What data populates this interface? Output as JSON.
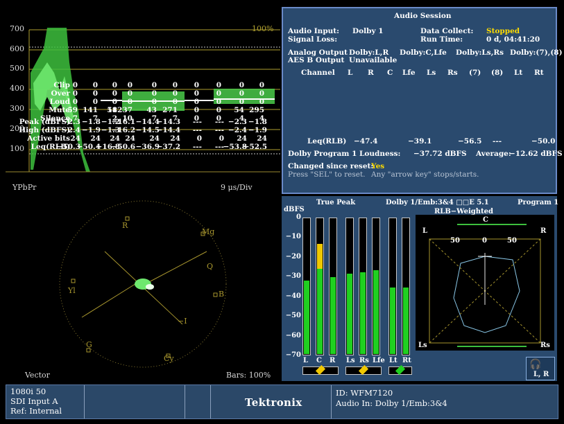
{
  "waveform": {
    "ticks": [
      "700",
      "600",
      "500",
      "400",
      "300",
      "200",
      "100"
    ],
    "percent": "100%",
    "format": "YPbPr",
    "scale": "9 μs/Div"
  },
  "audio_session": {
    "title": "Audio Session",
    "input_label": "Audio Input:",
    "input_value": "Dolby 1",
    "collect_label": "Data Collect:",
    "collect_value": "Stopped",
    "signal_loss": "Signal Loss:",
    "runtime_label": "Run Time:",
    "runtime_value": "0 d, 04:41:20",
    "analog_label": "Analog Output",
    "analog_vals": [
      "Dolby:L,R",
      "Dolby:C,Lfe",
      "Dolby:Ls,Rs",
      "Dolby:(7),(8)"
    ],
    "aes_label": "AES B Output",
    "aes_value": "Unavailable",
    "channel_header": "Channel",
    "columns": [
      "L",
      "R",
      "C",
      "Lfe",
      "Ls",
      "Rs",
      "(7)",
      "(8)",
      "Lt",
      "Rt"
    ],
    "rows": [
      {
        "label": "Clip",
        "vals": [
          "0",
          "0",
          "0",
          "0",
          "0",
          "0",
          "0",
          "0",
          "0",
          "0"
        ]
      },
      {
        "label": "Over",
        "vals": [
          "0",
          "0",
          "0",
          "0",
          "0",
          "0",
          "0",
          "0",
          "0",
          "0"
        ]
      },
      {
        "label": "Loud",
        "vals": [
          "0",
          "0",
          "0",
          "0",
          "0",
          "0",
          "0",
          "0",
          "0",
          "0"
        ]
      },
      {
        "label": "Mute",
        "vals": [
          "59",
          "141",
          "51",
          "18237",
          "43",
          "271",
          "0",
          "0",
          "54",
          "295"
        ]
      },
      {
        "label": "Silence",
        "vals": [
          "7",
          "7",
          "2",
          "10",
          "7",
          "7",
          "0",
          "0",
          "4",
          "4"
        ]
      }
    ],
    "rows2": [
      {
        "label": "Peak (dBFS)",
        "vals": [
          "−2.3",
          "−1.8",
          "−1.2",
          "−16.1",
          "−14.4",
          "−14.3",
          "---",
          "---",
          "−2.3",
          "−1.8"
        ]
      },
      {
        "label": "High (dBFS)",
        "vals": [
          "−2.4",
          "−1.9",
          "−1.3",
          "−16.2",
          "−14.5",
          "−14.4",
          "---",
          "---",
          "−2.4",
          "−1.9"
        ]
      },
      {
        "label": "Active bits",
        "vals": [
          "24",
          "24",
          "24",
          "24",
          "24",
          "24",
          "0",
          "0",
          "24",
          "24"
        ]
      },
      {
        "label": "Leq(RLB)",
        "vals": [
          "−50.3",
          "−50.4",
          "−16.8",
          "−50.6",
          "−36.9",
          "−37.2",
          "---",
          "---",
          "−53.8",
          "−52.5"
        ]
      }
    ],
    "leq_label": "Leq(RLB)",
    "leq_pairs": [
      "−47.4",
      "−39.1",
      "−56.5",
      "---",
      "−50.0"
    ],
    "loudness_label": "Dolby Program 1 Loudness:",
    "loudness_value": "−37.72 dBFS",
    "average_label": "Average:",
    "average_value": "−12.62 dBFS",
    "changed_label": "Changed since reset:",
    "changed_value": "Yes",
    "hint1": "Press \"SEL\" to reset.",
    "hint2": "Any \"arrow key\" stops/starts."
  },
  "vector": {
    "label": "Vector",
    "bars": "Bars: 100%",
    "targets": {
      "R": "R",
      "Mg": "Mg",
      "Q": "Q",
      "B": "B",
      "I": "−I",
      "Cy": "Cy",
      "G": "G",
      "Yl": "Yl"
    }
  },
  "meters": {
    "true_peak": "True Peak",
    "source": "Dolby 1/Emb:3&4  □□E 5.1",
    "program": "Program 1",
    "dbfs": "dBFS",
    "ticks": [
      "0",
      "−10",
      "−20",
      "−30",
      "−40",
      "−50",
      "−60",
      "−70"
    ],
    "channels": [
      "L",
      "C",
      "R",
      "Ls",
      "Rs",
      "Lfe",
      "Lt",
      "Rt"
    ],
    "levels": [
      0.24,
      0.82,
      0.2,
      0.17,
      0.15,
      0.13,
      0.31,
      0.31
    ],
    "rlb": "RLB−Weighted",
    "lissa": {
      "C": "C",
      "L": "L",
      "R": "R",
      "Ls": "Ls",
      "Rs": "Rs",
      "a": "50",
      "b": "0",
      "c": "50"
    },
    "indicator": "L, R"
  },
  "status": {
    "format": "1080i 50",
    "input": "SDI Input A",
    "ref": "Ref: Internal",
    "brand": "Tektronix",
    "id": "ID: WFM7120",
    "audio_in": "Audio In: Dolby 1/Emb:3&4"
  }
}
